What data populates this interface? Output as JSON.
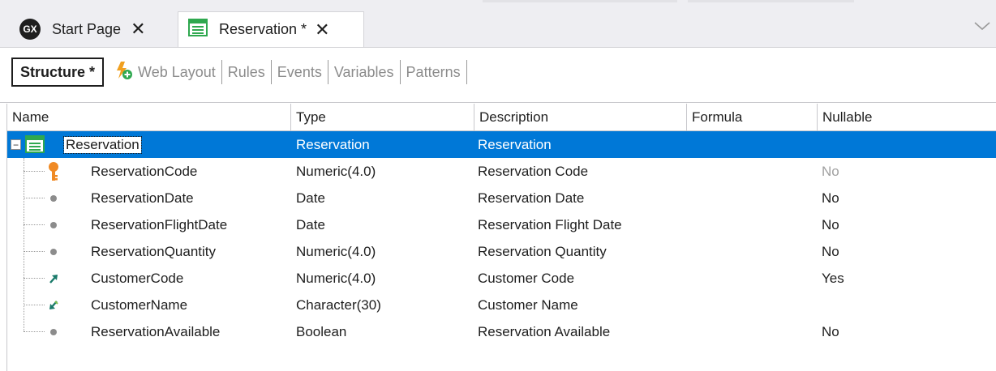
{
  "tabs": [
    {
      "label": "Start Page",
      "icon": "gx-icon",
      "close": "✕"
    },
    {
      "label": "Reservation *",
      "icon": "transaction-icon",
      "close": "✕"
    }
  ],
  "gx_icon_text": "GX",
  "subtabs": {
    "structure": "Structure *",
    "web_layout": "Web Layout",
    "rules": "Rules",
    "events": "Events",
    "variables": "Variables",
    "patterns": "Patterns"
  },
  "columns": {
    "name": "Name",
    "type": "Type",
    "description": "Description",
    "formula": "Formula",
    "nullable": "Nullable"
  },
  "root": {
    "name": "Reservation",
    "type": "Reservation",
    "description": "Reservation",
    "expander": "−"
  },
  "attributes": [
    {
      "name": "ReservationCode",
      "type": "Numeric(4.0)",
      "description": "Reservation Code",
      "nullable": "No",
      "icon": "key-icon"
    },
    {
      "name": "ReservationDate",
      "type": "Date",
      "description": "Reservation Date",
      "nullable": "No",
      "icon": "dot-icon"
    },
    {
      "name": "ReservationFlightDate",
      "type": "Date",
      "description": "Reservation Flight Date",
      "nullable": "No",
      "icon": "dot-icon"
    },
    {
      "name": "ReservationQuantity",
      "type": "Numeric(4.0)",
      "description": "Reservation Quantity",
      "nullable": "No",
      "icon": "dot-icon"
    },
    {
      "name": "CustomerCode",
      "type": "Numeric(4.0)",
      "description": "Customer Code",
      "nullable": "Yes",
      "icon": "foreign-key-arrow-icon"
    },
    {
      "name": "CustomerName",
      "type": "Character(30)",
      "description": "Customer Name",
      "nullable": "",
      "icon": "inferred-arrow-icon"
    },
    {
      "name": "ReservationAvailable",
      "type": "Boolean",
      "description": "Reservation Available",
      "nullable": "No",
      "icon": "dot-icon"
    }
  ],
  "colors": {
    "selection": "#0078d7",
    "key": "#f08a24",
    "arrow": "#1a7a6a",
    "transaction_green": "#2fa84f"
  }
}
